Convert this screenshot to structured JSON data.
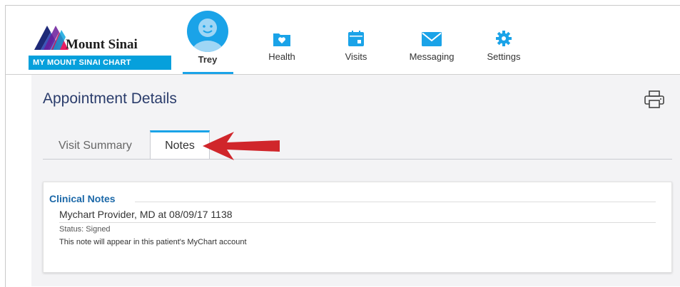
{
  "brand": {
    "name": "Mount Sinai",
    "portal": "MY MOUNT SINAI CHART",
    "accent_color": "#06a0dc"
  },
  "nav": {
    "items": [
      {
        "label": "Trey",
        "icon": "avatar-icon",
        "active": true
      },
      {
        "label": "Health",
        "icon": "folder-heart-icon"
      },
      {
        "label": "Visits",
        "icon": "calendar-icon"
      },
      {
        "label": "Messaging",
        "icon": "envelope-icon"
      },
      {
        "label": "Settings",
        "icon": "gear-icon"
      }
    ]
  },
  "page": {
    "title": "Appointment Details",
    "print_icon": "printer-icon"
  },
  "tabs": [
    {
      "label": "Visit Summary",
      "active": false
    },
    {
      "label": "Notes",
      "active": true
    }
  ],
  "annotation": {
    "icon": "red-arrow-icon",
    "color": "#d0262b"
  },
  "clinical_notes": {
    "title": "Clinical Notes",
    "note": {
      "header": "Mychart Provider, MD at 08/09/17 1138",
      "status": "Status: Signed",
      "body": "This note will appear in this patient's MyChart account"
    }
  }
}
